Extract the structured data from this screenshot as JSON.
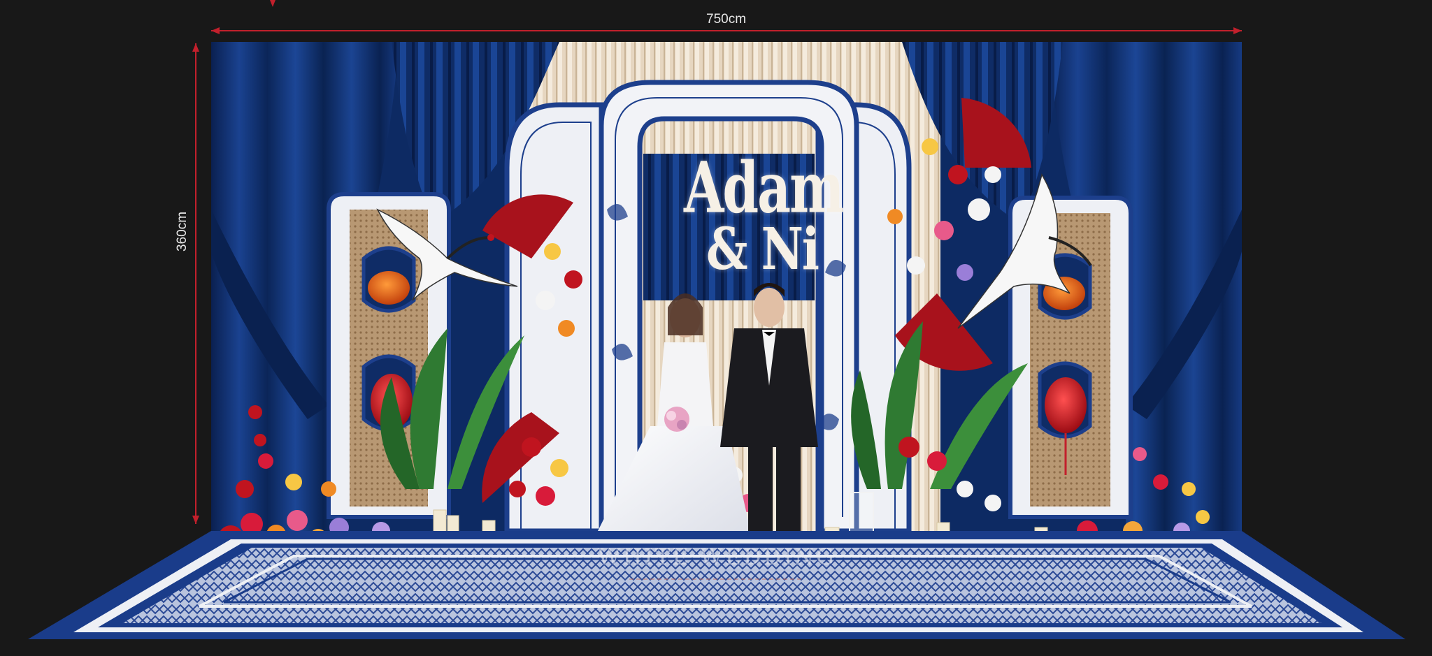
{
  "dimensions": {
    "width_label": "750cm",
    "height_label": "360cm",
    "line_color": "#c2202c"
  },
  "backdrop": {
    "names_line_1": "Adam",
    "names_line_2": "& Ni",
    "brand": "WHITE WEDDING"
  },
  "colors": {
    "background": "#181818",
    "curtain_blue": "#0e2c66",
    "porcelain_white": "#eef0f5",
    "porcelain_blue": "#1d3f8c",
    "fan_red": "#a8121c",
    "carpet_blue": "#1a3c8a"
  }
}
